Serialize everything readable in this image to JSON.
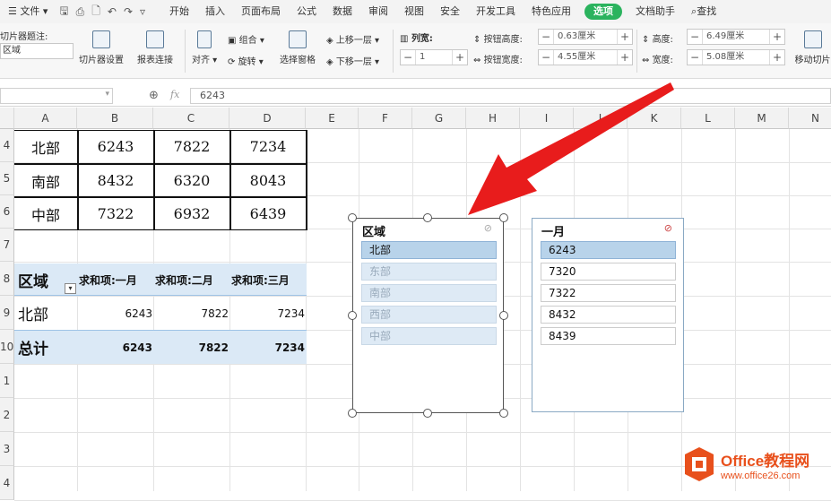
{
  "menu": {
    "file": "文件",
    "tabs": [
      "开始",
      "插入",
      "页面布局",
      "公式",
      "数据",
      "审阅",
      "视图",
      "安全",
      "开发工具",
      "特色应用",
      "选项",
      "文档助手"
    ],
    "active_tab": "选项",
    "search": "查找"
  },
  "ribbon": {
    "caption_label": "切片器题注:",
    "caption_value": "区域",
    "slicer_settings": "切片器设置",
    "report_connections": "报表连接",
    "align": "对齐",
    "group": "组合",
    "rotate": "旋转",
    "selection_pane": "选择窗格",
    "bring_forward": "上移一层",
    "send_backward": "下移一层",
    "columns_label": "列宽:",
    "columns_value": "1",
    "btn_height_label": "按钮高度:",
    "btn_height_value": "0.63厘米",
    "btn_width_label": "按钮宽度:",
    "btn_width_value": "4.55厘米",
    "height_label": "高度:",
    "height_value": "6.49厘米",
    "width_label": "宽度:",
    "width_value": "5.08厘米",
    "move_slicer": "移动切片"
  },
  "formula_bar": {
    "fx": "fx",
    "value": "6243"
  },
  "columns": [
    "A",
    "B",
    "C",
    "D",
    "E",
    "F",
    "G",
    "H",
    "I",
    "J",
    "K",
    "L",
    "M",
    "N"
  ],
  "rows": [
    "4",
    "5",
    "6",
    "7",
    "8",
    "9",
    "10",
    "1",
    "2",
    "3",
    "4"
  ],
  "table": [
    [
      "北部",
      "6243",
      "7822",
      "7234"
    ],
    [
      "南部",
      "8432",
      "6320",
      "8043"
    ],
    [
      "中部",
      "7322",
      "6932",
      "6439"
    ]
  ],
  "pivot": {
    "header": [
      "区域",
      "求和项:一月",
      "求和项:二月",
      "求和项:三月"
    ],
    "row": [
      "北部",
      "6243",
      "7822",
      "7234"
    ],
    "total": [
      "总计",
      "6243",
      "7822",
      "7234"
    ]
  },
  "slicer_region": {
    "title": "区域",
    "items": [
      "北部",
      "东部",
      "南部",
      "西部",
      "中部"
    ],
    "selected": "北部"
  },
  "slicer_month": {
    "title": "一月",
    "items": [
      "6243",
      "7320",
      "7322",
      "8432",
      "8439"
    ],
    "selected": "6243"
  },
  "watermark": {
    "brand": "Office教程网",
    "url": "www.office26.com"
  },
  "colors": {
    "accent_green": "#2bb35e",
    "slicer_selected": "#b8d3ea",
    "pivot_fill": "#dbe9f6",
    "arrow": "#e81c1c",
    "watermark_orange": "#e8501c"
  }
}
